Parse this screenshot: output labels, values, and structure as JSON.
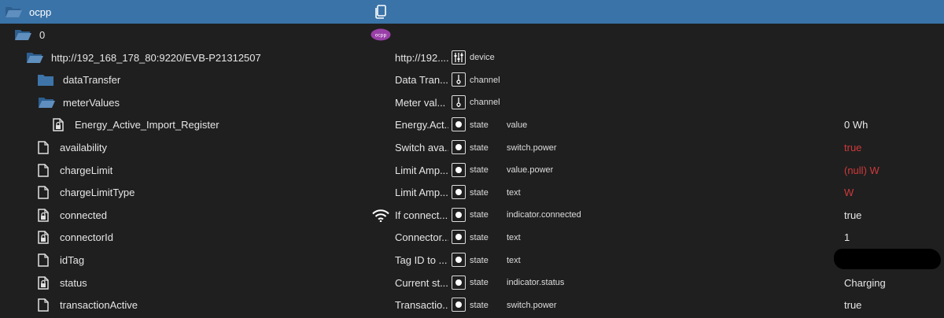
{
  "header": {
    "title": "ocpp",
    "copy_icon": "copy-icon"
  },
  "rows": [
    {
      "id": "instance",
      "name": "0",
      "kind": "folder-open",
      "level": 1,
      "adapter_logo": "ocpp-logo"
    },
    {
      "id": "device",
      "name": "http://192_168_178_80:9220/EVB-P21312507",
      "kind": "folder-open",
      "level": 2,
      "desc": "http://192....",
      "type": "device"
    },
    {
      "id": "dataTransfer",
      "name": "dataTransfer",
      "kind": "folder",
      "level": 3,
      "desc": "Data Tran...",
      "type": "channel"
    },
    {
      "id": "meterValues",
      "name": "meterValues",
      "kind": "folder-open",
      "level": 3,
      "desc": "Meter val...",
      "type": "channel"
    },
    {
      "id": "energy",
      "name": "Energy_Active_Import_Register",
      "kind": "file-locked",
      "level": 4,
      "desc": "Energy.Act...",
      "type": "state",
      "role": "value",
      "value": "0 Wh"
    },
    {
      "id": "availability",
      "name": "availability",
      "kind": "file",
      "level": 3,
      "desc": "Switch ava...",
      "type": "state",
      "role": "switch.power",
      "value": "true",
      "value_error": true
    },
    {
      "id": "chargeLimit",
      "name": "chargeLimit",
      "kind": "file",
      "level": 3,
      "desc": "Limit Amp...",
      "type": "state",
      "role": "value.power",
      "value": "(null) W",
      "value_error": true
    },
    {
      "id": "chargeLimitType",
      "name": "chargeLimitType",
      "kind": "file",
      "level": 3,
      "desc": "Limit Amp...",
      "type": "state",
      "role": "text",
      "value": "W",
      "value_error": true
    },
    {
      "id": "connected",
      "name": "connected",
      "kind": "file-locked",
      "level": 3,
      "desc": "If connect...",
      "type": "state",
      "role": "indicator.connected",
      "value": "true",
      "extra_icon": "wifi-icon"
    },
    {
      "id": "connectorId",
      "name": "connectorId",
      "kind": "file-locked",
      "level": 3,
      "desc": "Connector...",
      "type": "state",
      "role": "text",
      "value": "1"
    },
    {
      "id": "idTag",
      "name": "idTag",
      "kind": "file",
      "level": 3,
      "desc": "Tag ID to ...",
      "type": "state",
      "role": "text",
      "value": ""
    },
    {
      "id": "status",
      "name": "status",
      "kind": "file-locked",
      "level": 3,
      "desc": "Current st...",
      "type": "state",
      "role": "indicator.status",
      "value": "Charging"
    },
    {
      "id": "transactionActive",
      "name": "transactionActive",
      "kind": "file",
      "level": 3,
      "desc": "Transactio...",
      "type": "state",
      "role": "switch.power",
      "value": "true"
    }
  ]
}
